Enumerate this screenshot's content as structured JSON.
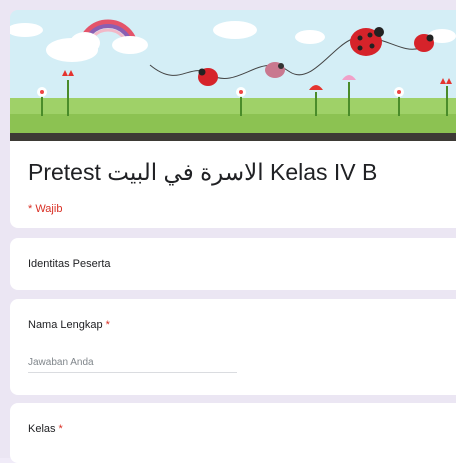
{
  "form": {
    "title": "Pretest الاسرة في البيت Kelas IV B",
    "required_note": "* Wajib"
  },
  "section": {
    "title": "Identitas Peserta"
  },
  "questions": [
    {
      "label": "Nama Lengkap",
      "required_mark": "*",
      "placeholder": "Jawaban Anda"
    },
    {
      "label": "Kelas",
      "required_mark": "*"
    }
  ],
  "colors": {
    "background": "#ebe6f3",
    "header_bar": "#3d3a35",
    "required": "#d93025"
  }
}
